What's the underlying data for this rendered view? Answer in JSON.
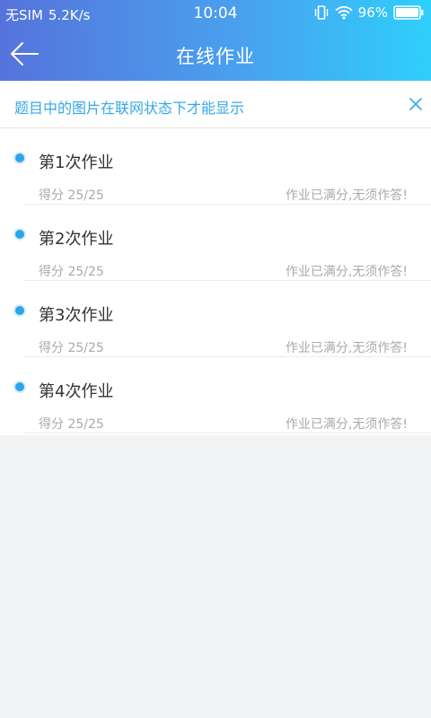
{
  "status_bar": {
    "carrier": "无SIM",
    "speed": "5.2K/s",
    "time": "10:04",
    "battery": "96%"
  },
  "header": {
    "title": "在线作业",
    "back_icon": "arrow-left-icon",
    "gradient_colors": [
      "#5673dc",
      "#2ecffb"
    ]
  },
  "notice": {
    "text": "题目中的图片在联网状态下才能显示",
    "close_icon": "close-icon",
    "color": "#34a8e8"
  },
  "homework_list": [
    {
      "title": "第1次作业",
      "score": "得分 25/25",
      "status": "作业已满分,无须作答!"
    },
    {
      "title": "第2次作业",
      "score": "得分 25/25",
      "status": "作业已满分,无须作答!"
    },
    {
      "title": "第3次作业",
      "score": "得分 25/25",
      "status": "作业已满分,无须作答!"
    },
    {
      "title": "第4次作业",
      "score": "得分 25/25",
      "status": "作业已满分,无须作答!"
    }
  ]
}
